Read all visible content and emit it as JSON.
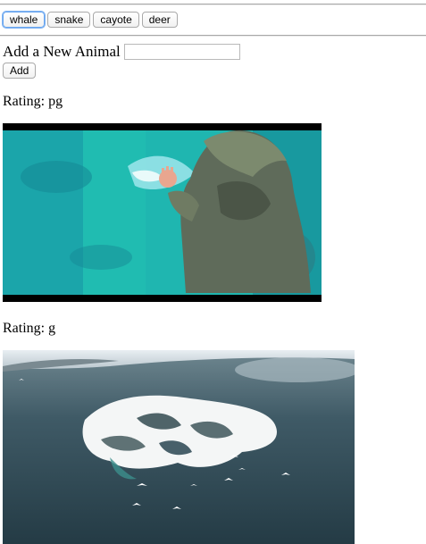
{
  "animals": {
    "buttons": [
      {
        "label": "whale",
        "active": true
      },
      {
        "label": "snake",
        "active": false
      },
      {
        "label": "cayote",
        "active": false
      },
      {
        "label": "deer",
        "active": false
      }
    ]
  },
  "form": {
    "label": "Add a New Animal",
    "input_value": "",
    "input_placeholder": "",
    "submit_label": "Add"
  },
  "results": [
    {
      "rating": "Rating: pg"
    },
    {
      "rating": "Rating: g"
    }
  ],
  "colors": {
    "button_focus": "#6aa6ef",
    "aqua": "#1fb6b0",
    "teal": "#168f95",
    "ocean_dark": "#2a4652",
    "foam": "#f4f6f6"
  }
}
